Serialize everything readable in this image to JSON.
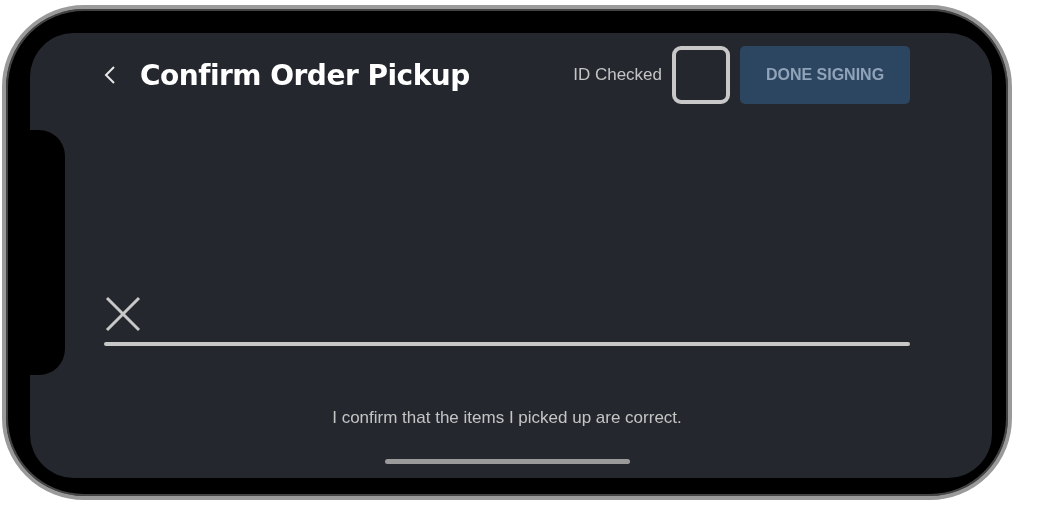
{
  "header": {
    "title": "Confirm Order Pickup",
    "id_checked": {
      "label": "ID Checked",
      "checked": false
    },
    "done_button": {
      "label": "DONE SIGNING",
      "disabled": true
    }
  },
  "signature": {
    "caption": "I confirm that the items I picked up are correct."
  }
}
